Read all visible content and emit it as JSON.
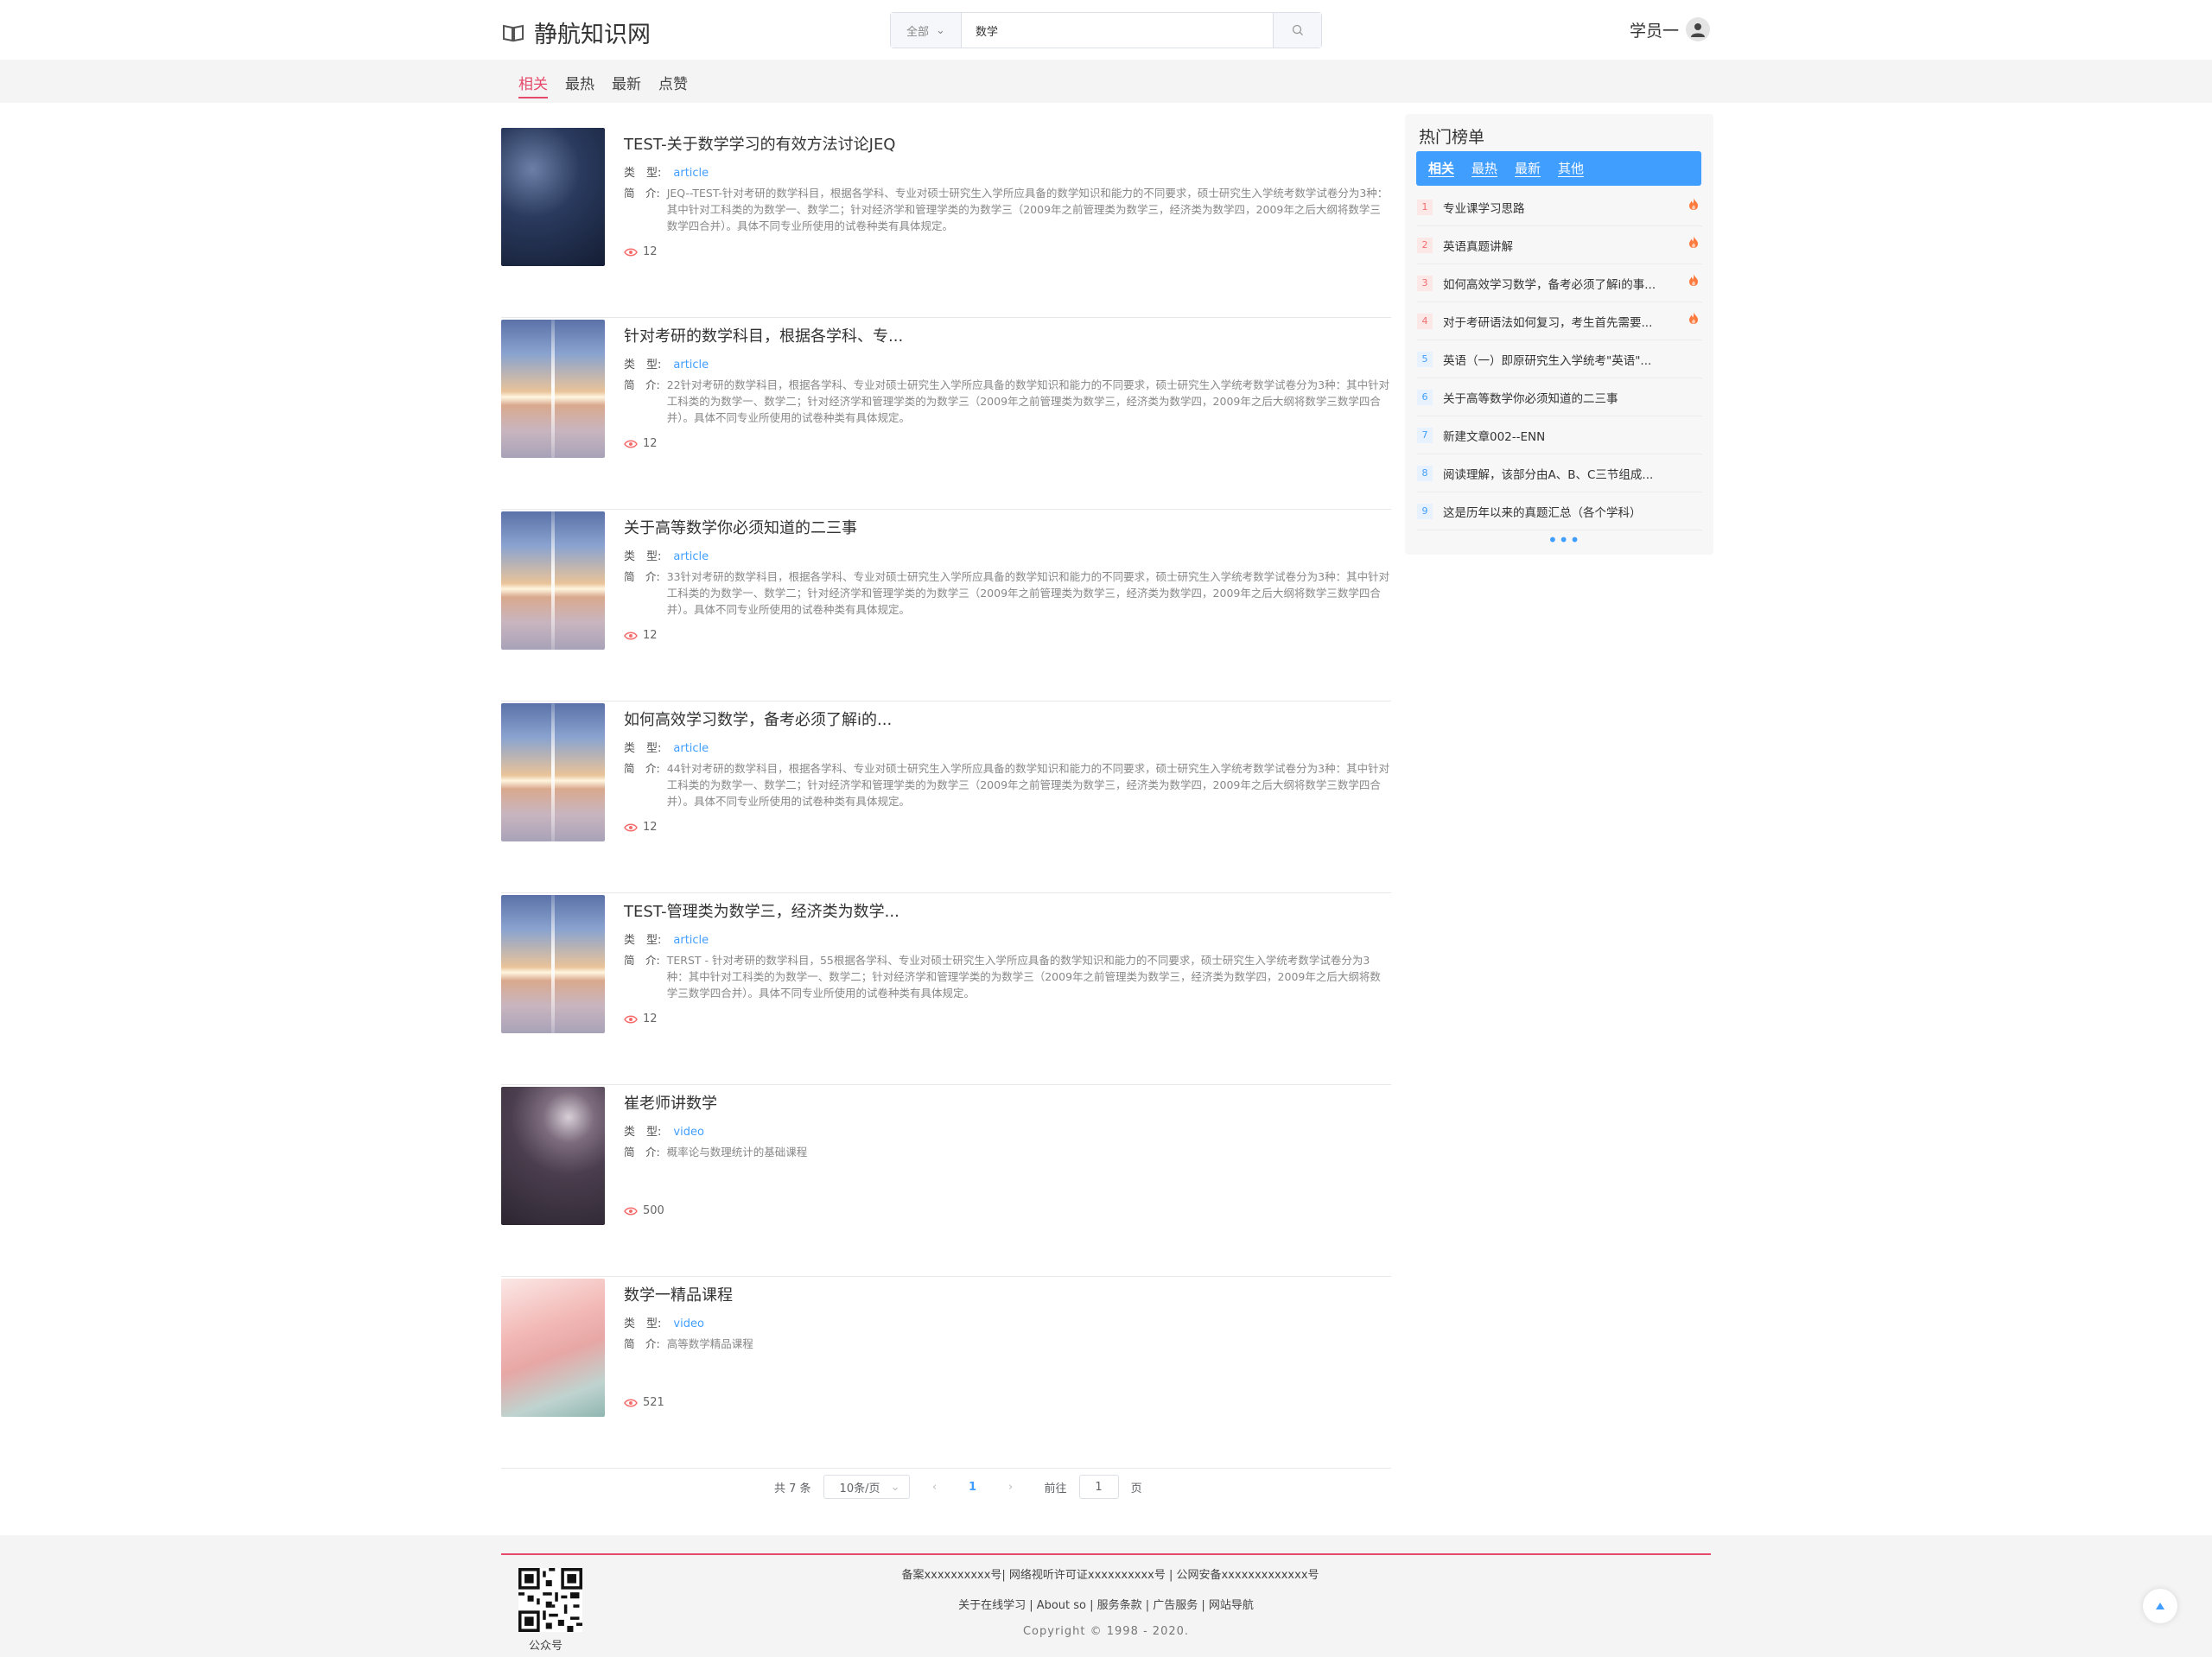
{
  "header": {
    "site_name": "静航知识网",
    "search_scope": "全部",
    "search_value": "数学",
    "user_name": "学员一"
  },
  "subnav": [
    "相关",
    "最热",
    "最新",
    "点赞"
  ],
  "results": [
    {
      "title": "TEST-关于数学学习的有效方法讨论JEQ",
      "type_label": "类　型:",
      "type": "article",
      "desc_label": "简　介:",
      "desc": "JEQ--TEST-针对考研的数学科目，根据各学科、专业对硕士研究生入学所应具备的数学知识和能力的不同要求，硕士研究生入学统考数学试卷分为3种：其中针对工科类的为数学一、数学二；针对经济学和管理学类的为数学三（2009年之前管理类为数学三，经济类为数学四，2009年之后大纲将数学三数学四合并）。具体不同专业所使用的试卷种类有具体规定。",
      "views": "12",
      "thumb": "book"
    },
    {
      "title": "针对考研的数学科目，根据各学科、专...",
      "type_label": "类　型:",
      "type": "article",
      "desc_label": "简　介:",
      "desc": "22针对考研的数学科目，根据各学科、专业对硕士研究生入学所应具备的数学知识和能力的不同要求，硕士研究生入学统考数学试卷分为3种：其中针对工科类的为数学一、数学二；针对经济学和管理学类的为数学三（2009年之前管理类为数学三，经济类为数学四，2009年之后大纲将数学三数学四合并）。具体不同专业所使用的试卷种类有具体规定。",
      "views": "12",
      "thumb": "sky"
    },
    {
      "title": "关于高等数学你必须知道的二三事",
      "type_label": "类　型:",
      "type": "article",
      "desc_label": "简　介:",
      "desc": "33针对考研的数学科目，根据各学科、专业对硕士研究生入学所应具备的数学知识和能力的不同要求，硕士研究生入学统考数学试卷分为3种：其中针对工科类的为数学一、数学二；针对经济学和管理学类的为数学三（2009年之前管理类为数学三，经济类为数学四，2009年之后大纲将数学三数学四合并）。具体不同专业所使用的试卷种类有具体规定。",
      "views": "12",
      "thumb": "sky"
    },
    {
      "title": "如何高效学习数学，备考必须了解i的...",
      "type_label": "类　型:",
      "type": "article",
      "desc_label": "简　介:",
      "desc": "44针对考研的数学科目，根据各学科、专业对硕士研究生入学所应具备的数学知识和能力的不同要求，硕士研究生入学统考数学试卷分为3种：其中针对工科类的为数学一、数学二；针对经济学和管理学类的为数学三（2009年之前管理类为数学三，经济类为数学四，2009年之后大纲将数学三数学四合并）。具体不同专业所使用的试卷种类有具体规定。",
      "views": "12",
      "thumb": "sky"
    },
    {
      "title": "TEST-管理类为数学三，经济类为数学...",
      "type_label": "类　型:",
      "type": "article",
      "desc_label": "简　介:",
      "desc": "TERST - 针对考研的数学科目，55根据各学科、专业对硕士研究生入学所应具备的数学知识和能力的不同要求，硕士研究生入学统考数学试卷分为3种：其中针对工科类的为数学一、数学二；针对经济学和管理学类的为数学三（2009年之前管理类为数学三，经济类为数学四，2009年之后大纲将数学三数学四合并）。具体不同专业所使用的试卷种类有具体规定。",
      "views": "12",
      "thumb": "sky"
    },
    {
      "title": "崔老师讲数学",
      "type_label": "类　型:",
      "type": "video",
      "desc_label": "简　介:",
      "desc": "概率论与数理统计的基础课程",
      "views": "500",
      "thumb": "firework"
    },
    {
      "title": "数学一精品课程",
      "type_label": "类　型:",
      "type": "video",
      "desc_label": "简　介:",
      "desc": "高等数学精品课程",
      "views": "521",
      "thumb": "pink"
    }
  ],
  "pagination": {
    "total": "共 7 条",
    "page_size": "10条/页",
    "prev": "‹",
    "current": "1",
    "next": "›",
    "goto_label": "前往",
    "goto_value": "1",
    "page_suffix": "页"
  },
  "sidebar": {
    "title": "热门榜单",
    "tabs": [
      "相关",
      "最热",
      "最新",
      "其他"
    ],
    "items": [
      {
        "no": "1",
        "text": "专业课学习思路",
        "hot": true
      },
      {
        "no": "2",
        "text": "英语真题讲解",
        "hot": true
      },
      {
        "no": "3",
        "text": "如何高效学习数学，备考必须了解i的事...",
        "hot": true
      },
      {
        "no": "4",
        "text": "对于考研语法如何复习，考生首先需要...",
        "hot": true
      },
      {
        "no": "5",
        "text": "英语（一）即原研究生入学统考\"英语\"...",
        "hot": false
      },
      {
        "no": "6",
        "text": "关于高等数学你必须知道的二三事",
        "hot": false
      },
      {
        "no": "7",
        "text": "新建文章002--ENN",
        "hot": false
      },
      {
        "no": "8",
        "text": "阅读理解，该部分由A、B、C三节组成...",
        "hot": false
      },
      {
        "no": "9",
        "text": "这是历年以来的真题汇总（各个学科）",
        "hot": false
      }
    ],
    "more": "•••"
  },
  "footer": {
    "line1": "备案xxxxxxxxxx号| 网络视听许可证xxxxxxxxxx号 | 公网安备xxxxxxxxxxxxx号",
    "line2": "关于在线学习 | About so | 服务条款 | 广告服务 | 网站导航",
    "line3": "Copyright © 1998 - 2020.",
    "qr_label": "公众号"
  },
  "colors": {
    "accent": "#409eff",
    "brand_pink": "#e64a6a",
    "hot": "#f56c6c",
    "fire": "#ff7a3d"
  }
}
